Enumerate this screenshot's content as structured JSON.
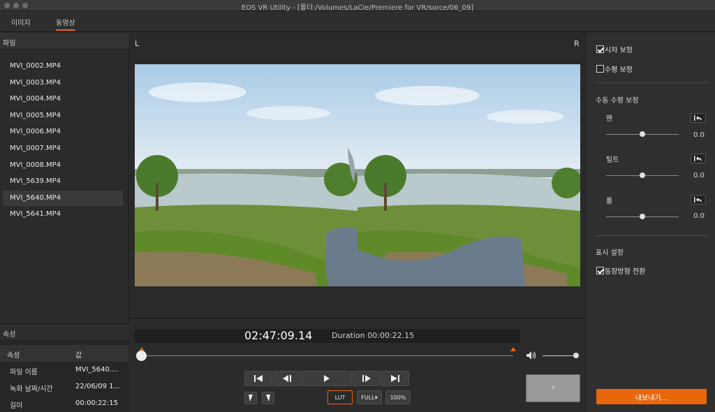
{
  "window": {
    "title": "EOS VR Utility - [폴더:/Volumes/LaCie/Premiere for VR/sorce/06_09]"
  },
  "tabs": [
    {
      "label": "이미지"
    },
    {
      "label": "동영상",
      "active": true
    }
  ],
  "files": {
    "header": "파일",
    "items": [
      "MVI_0002.MP4",
      "MVI_0003.MP4",
      "MVI_0004.MP4",
      "MVI_0005.MP4",
      "MVI_0006.MP4",
      "MVI_0007.MP4",
      "MVI_0008.MP4",
      "MVI_5639.MP4",
      "MVI_5640.MP4",
      "MVI_5641.MP4"
    ],
    "selected": "MVI_5640.MP4"
  },
  "properties": {
    "header": "속성",
    "col_attr": "속성",
    "col_value": "값",
    "rows": [
      {
        "label": "파일 이름",
        "value": "MVI_5640...."
      },
      {
        "label": "녹화 날짜/시간",
        "value": "22/06/09 1..."
      },
      {
        "label": "길이",
        "value": "00:00:22:15"
      }
    ]
  },
  "viewer": {
    "left_label": "L",
    "right_label": "R"
  },
  "transport": {
    "timecode": "02:47:09.14",
    "duration": "Duration 00:00:22.15",
    "position": 0.0,
    "volume": 1.0,
    "lut_label": "LUT",
    "full_label": "FULL▾",
    "zoom_label": "100%"
  },
  "adjust": {
    "parallax": {
      "label": "시차 보정",
      "checked": true
    },
    "level": {
      "label": "수평 보정",
      "checked": false
    },
    "manual_header": "수동 수평 보정",
    "sliders": [
      {
        "label": "팬",
        "value": "0.0",
        "position": 0.5
      },
      {
        "label": "틸트",
        "value": "0.0",
        "position": 0.5
      },
      {
        "label": "롤",
        "value": "0.0",
        "position": 0.5
      }
    ],
    "display_header": "표시 설정",
    "equirect": {
      "label": "등장방형 전환",
      "checked": true
    },
    "export_label": "내보내기..."
  },
  "colors": {
    "accent": "#e8660c",
    "panel": "#2b2b2b"
  }
}
